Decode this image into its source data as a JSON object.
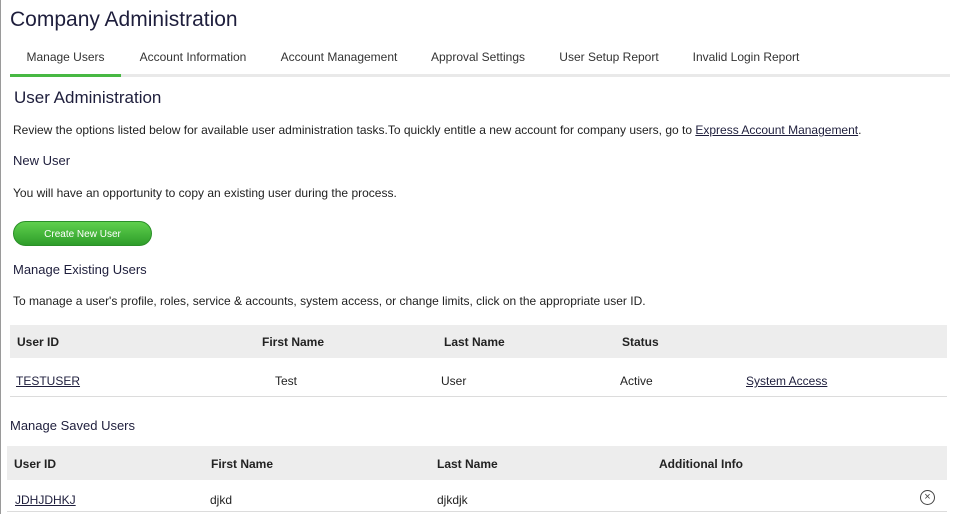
{
  "app": {
    "title": "Company Administration"
  },
  "tabs": [
    {
      "label": "Manage Users",
      "active": true
    },
    {
      "label": "Account Information"
    },
    {
      "label": "Account Management"
    },
    {
      "label": "Approval Settings"
    },
    {
      "label": "User Setup Report"
    },
    {
      "label": "Invalid Login Report"
    }
  ],
  "main": {
    "title": "User Administration",
    "intro_text": "Review the options listed below for available user administration tasks.To quickly entitle a new account for company users, go to ",
    "intro_link": "Express Account Management",
    "intro_end": ".",
    "new_user": {
      "heading": "New User",
      "text": "You will have an opportunity to copy an existing user during the process.",
      "button": "Create New User"
    },
    "existing": {
      "heading": "Manage Existing Users",
      "text": "To manage a user's profile, roles, service & accounts, system access, or change limits, click on the appropriate user ID.",
      "columns": [
        "User ID",
        "First Name",
        "Last Name",
        "Status"
      ],
      "rows": [
        {
          "user_id": "TESTUSER",
          "first": "Test",
          "last": "User",
          "status": "Active",
          "action": "System Access"
        }
      ]
    },
    "saved": {
      "heading": "Manage Saved Users",
      "columns": [
        "User ID",
        "First Name",
        "Last Name",
        "Additional Info"
      ],
      "rows": [
        {
          "user_id": "JDHJDHKJ",
          "first": "djkd",
          "last": "djkdjk",
          "info": "",
          "remove_icon": "circle-x-icon"
        }
      ]
    }
  },
  "colors": {
    "accent": "#47b843",
    "title": "#1e1e3c",
    "header_bg": "#ededed"
  }
}
